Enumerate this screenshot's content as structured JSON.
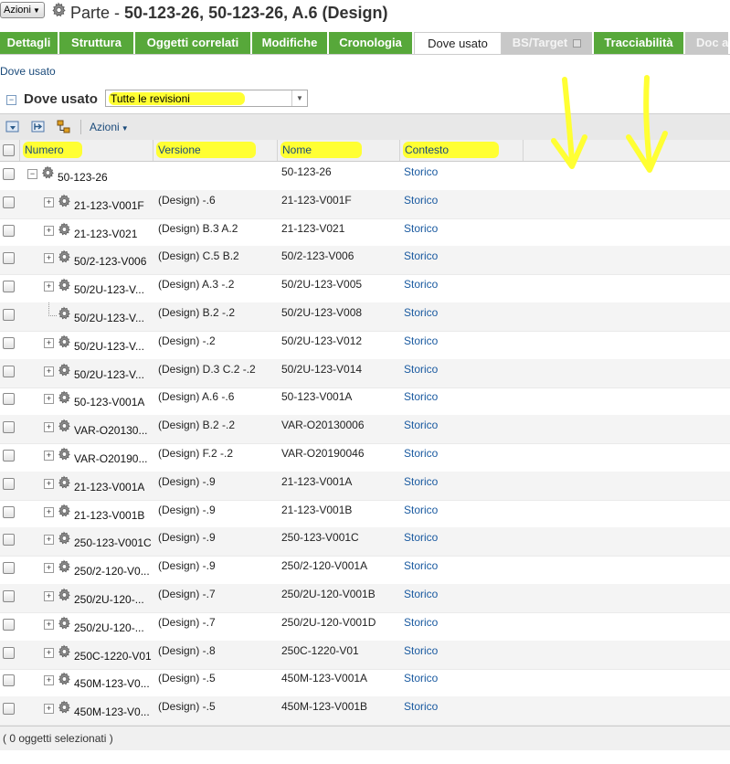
{
  "header": {
    "actions_label": "Azioni",
    "title_prefix": "Parte - ",
    "title_main": "50-123-26, 50-123-26, A.6 (Design)"
  },
  "tabs": [
    {
      "label": "Dettagli",
      "state": "normal"
    },
    {
      "label": "Struttura",
      "state": "normal"
    },
    {
      "label": "Oggetti correlati",
      "state": "normal"
    },
    {
      "label": "Modifiche",
      "state": "normal"
    },
    {
      "label": "Cronologia",
      "state": "normal"
    },
    {
      "label": "Dove usato",
      "state": "active"
    },
    {
      "label": "BS/Target",
      "state": "disabled"
    },
    {
      "label": "Tracciabilità",
      "state": "normal"
    },
    {
      "label": "Doc a",
      "state": "disabled"
    }
  ],
  "breadcrumb": "Dove usato",
  "section": {
    "title": "Dove usato",
    "revision_filter": "Tutte le revisioni"
  },
  "toolbar": {
    "actions_label": "Azioni"
  },
  "table": {
    "columns": [
      "Numero",
      "Versione",
      "Nome",
      "Contesto"
    ],
    "rows": [
      {
        "numero": "50-123-26",
        "versione": "",
        "nome": "50-123-26",
        "contesto": "Storico",
        "level": 0,
        "expander": "minus"
      },
      {
        "numero": "21-123-V001F",
        "versione": "(Design) -.6",
        "nome": "21-123-V001F",
        "contesto": "Storico",
        "level": 1,
        "expander": "plus"
      },
      {
        "numero": "21-123-V021",
        "versione": "(Design) B.3 A.2",
        "nome": "21-123-V021",
        "contesto": "Storico",
        "level": 1,
        "expander": "plus"
      },
      {
        "numero": "50/2-123-V006",
        "versione": "(Design) C.5 B.2",
        "nome": "50/2-123-V006",
        "contesto": "Storico",
        "level": 1,
        "expander": "plus"
      },
      {
        "numero": "50/2U-123-V...",
        "versione": "(Design) A.3 -.2",
        "nome": "50/2U-123-V005",
        "contesto": "Storico",
        "level": 1,
        "expander": "plus"
      },
      {
        "numero": "50/2U-123-V...",
        "versione": "(Design) B.2 -.2",
        "nome": "50/2U-123-V008",
        "contesto": "Storico",
        "level": 1,
        "expander": "none"
      },
      {
        "numero": "50/2U-123-V...",
        "versione": "(Design) -.2",
        "nome": "50/2U-123-V012",
        "contesto": "Storico",
        "level": 1,
        "expander": "plus"
      },
      {
        "numero": "50/2U-123-V...",
        "versione": "(Design) D.3 C.2 -.2",
        "nome": "50/2U-123-V014",
        "contesto": "Storico",
        "level": 1,
        "expander": "plus"
      },
      {
        "numero": "50-123-V001A",
        "versione": "(Design) A.6 -.6",
        "nome": "50-123-V001A",
        "contesto": "Storico",
        "level": 1,
        "expander": "plus"
      },
      {
        "numero": "VAR-O20130...",
        "versione": "(Design) B.2 -.2",
        "nome": "VAR-O20130006",
        "contesto": "Storico",
        "level": 1,
        "expander": "plus"
      },
      {
        "numero": "VAR-O20190...",
        "versione": "(Design) F.2 -.2",
        "nome": "VAR-O20190046",
        "contesto": "Storico",
        "level": 1,
        "expander": "plus"
      },
      {
        "numero": "21-123-V001A",
        "versione": "(Design) -.9",
        "nome": "21-123-V001A",
        "contesto": "Storico",
        "level": 1,
        "expander": "plus"
      },
      {
        "numero": "21-123-V001B",
        "versione": "(Design) -.9",
        "nome": "21-123-V001B",
        "contesto": "Storico",
        "level": 1,
        "expander": "plus"
      },
      {
        "numero": "250-123-V001C",
        "versione": "(Design) -.9",
        "nome": "250-123-V001C",
        "contesto": "Storico",
        "level": 1,
        "expander": "plus"
      },
      {
        "numero": "250/2-120-V0...",
        "versione": "(Design) -.9",
        "nome": "250/2-120-V001A",
        "contesto": "Storico",
        "level": 1,
        "expander": "plus"
      },
      {
        "numero": "250/2U-120-...",
        "versione": "(Design) -.7",
        "nome": "250/2U-120-V001B",
        "contesto": "Storico",
        "level": 1,
        "expander": "plus"
      },
      {
        "numero": "250/2U-120-...",
        "versione": "(Design) -.7",
        "nome": "250/2U-120-V001D",
        "contesto": "Storico",
        "level": 1,
        "expander": "plus"
      },
      {
        "numero": "250C-1220-V01",
        "versione": "(Design) -.8",
        "nome": "250C-1220-V01",
        "contesto": "Storico",
        "level": 1,
        "expander": "plus"
      },
      {
        "numero": "450M-123-V0...",
        "versione": "(Design) -.5",
        "nome": "450M-123-V001A",
        "contesto": "Storico",
        "level": 1,
        "expander": "plus"
      },
      {
        "numero": "450M-123-V0...",
        "versione": "(Design) -.5",
        "nome": "450M-123-V001B",
        "contesto": "Storico",
        "level": 1,
        "expander": "plus"
      }
    ]
  },
  "footer": {
    "selection_status": "( 0 oggetti selezionati )"
  },
  "colors": {
    "tab_green": "#57a83a",
    "link_blue": "#1a4a7a",
    "highlighter_yellow": "#ffff33"
  }
}
